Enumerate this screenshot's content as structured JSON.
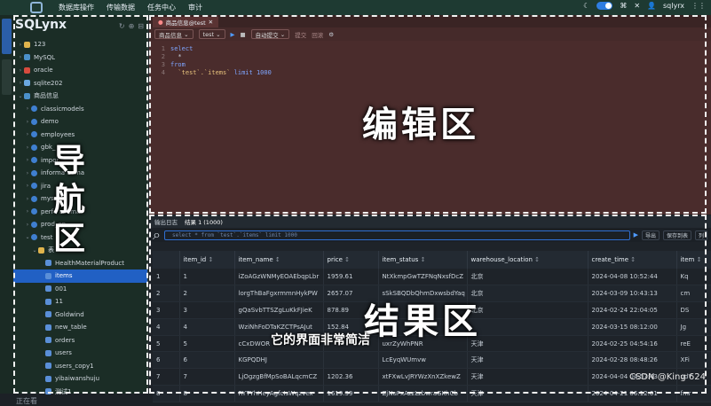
{
  "topbar": {
    "menu": [
      "数据库操作",
      "传输数据",
      "任务中心",
      "审计"
    ],
    "user": "sqlyrx"
  },
  "sidebar": {
    "brand": "SQLynx",
    "items": [
      {
        "label": "123",
        "icon": "folder",
        "indent": 1,
        "arrow": "›"
      },
      {
        "label": "MySQL",
        "icon": "mysql",
        "indent": 1,
        "arrow": "›"
      },
      {
        "label": "oracle",
        "icon": "oracle",
        "indent": 1,
        "arrow": "›"
      },
      {
        "label": "sqlite202",
        "icon": "sqlite",
        "indent": 1,
        "arrow": "›"
      },
      {
        "label": "商品信息",
        "icon": "mysql",
        "indent": 1,
        "arrow": "⌄"
      },
      {
        "label": "classicmodels",
        "icon": "db",
        "indent": 2,
        "arrow": "›"
      },
      {
        "label": "demo",
        "icon": "db",
        "indent": 2,
        "arrow": "›"
      },
      {
        "label": "employees",
        "icon": "db",
        "indent": 2,
        "arrow": "›"
      },
      {
        "label": "gbk_",
        "icon": "db",
        "indent": 2,
        "arrow": "›"
      },
      {
        "label": "impor",
        "icon": "db",
        "indent": 2,
        "arrow": "›"
      },
      {
        "label": "informa      hema",
        "icon": "db",
        "indent": 2,
        "arrow": "›"
      },
      {
        "label": "jira",
        "icon": "db",
        "indent": 2,
        "arrow": "›"
      },
      {
        "label": "mysq",
        "icon": "db",
        "indent": 2,
        "arrow": "›"
      },
      {
        "label": "perfo      chema",
        "icon": "db",
        "indent": 2,
        "arrow": "›"
      },
      {
        "label": "prod_op",
        "icon": "db",
        "indent": 2,
        "arrow": "›"
      },
      {
        "label": "test",
        "icon": "db",
        "indent": 2,
        "arrow": "⌄"
      },
      {
        "label": "表",
        "icon": "folder",
        "indent": 3,
        "arrow": "⌄"
      },
      {
        "label": "HealthMaterialProduct",
        "icon": "table",
        "indent": 4,
        "arrow": ""
      },
      {
        "label": "items",
        "icon": "table",
        "indent": 4,
        "arrow": "",
        "selected": true
      },
      {
        "label": "001",
        "icon": "table",
        "indent": 4,
        "arrow": ""
      },
      {
        "label": "11",
        "icon": "table",
        "indent": 4,
        "arrow": ""
      },
      {
        "label": "Goldwind",
        "icon": "table",
        "indent": 4,
        "arrow": ""
      },
      {
        "label": "new_table",
        "icon": "table",
        "indent": 4,
        "arrow": ""
      },
      {
        "label": "orders",
        "icon": "table",
        "indent": 4,
        "arrow": ""
      },
      {
        "label": "users",
        "icon": "table",
        "indent": 4,
        "arrow": ""
      },
      {
        "label": "users_copy1",
        "icon": "table",
        "indent": 4,
        "arrow": ""
      },
      {
        "label": "yibaiwanshuju",
        "icon": "table",
        "indent": 4,
        "arrow": ""
      },
      {
        "label": "测试1",
        "icon": "table",
        "indent": 4,
        "arrow": ""
      }
    ],
    "status": "正在看"
  },
  "editor": {
    "tab": "商品信息@test",
    "connection": "商品信息",
    "database": "test",
    "autocommit": "自动提交",
    "submit": "提交",
    "rollback": "回滚",
    "lines": [
      {
        "n": "1",
        "parts": [
          {
            "t": "select",
            "c": "kw"
          }
        ]
      },
      {
        "n": "2",
        "parts": [
          {
            "t": "  *",
            "c": ""
          }
        ]
      },
      {
        "n": "3",
        "parts": [
          {
            "t": "from",
            "c": "kw"
          }
        ]
      },
      {
        "n": "4",
        "parts": [
          {
            "t": "  `test`.`items` ",
            "c": "str"
          },
          {
            "t": "limit 1000",
            "c": "kw"
          }
        ]
      }
    ]
  },
  "results": {
    "tab_log": "输出日志",
    "tab_result": "结果 1 (1000)",
    "sql": "select * from `test`.`items` limit 1000",
    "export": "导出",
    "save": "保存到表",
    "columns_btn": "列",
    "headers": [
      "",
      "item_id",
      "item_name",
      "price",
      "item_status",
      "warehouse_location",
      "create_time",
      "item"
    ],
    "rows": [
      [
        "1",
        "1",
        "iZoAGzWNMyEOAEbqpLbr",
        "1959.61",
        "NtXkmpGwTZFNqNxsfDcZ",
        "北京",
        "2024-04-08 10:52:44",
        "Kq"
      ],
      [
        "2",
        "2",
        "lorgThBaFgxrmmnHykPW",
        "2657.07",
        "sSkSBQDbQhmDxwsbdYaq",
        "北京",
        "2024-03-09 10:43:13",
        "cm"
      ],
      [
        "3",
        "3",
        "gQaSvbTTSZgLuKkFJieK",
        "878.89",
        "",
        "北京",
        "2024-02-24 22:04:05",
        "DS"
      ],
      [
        "4",
        "4",
        "WziNhFoDTaKZCTPsAJut",
        "152.84",
        "",
        "",
        "2024-03-15 08:12:00",
        "Jg"
      ],
      [
        "5",
        "5",
        "cCxDWOR",
        "",
        "uxrZyWhPNR",
        "天津",
        "2024-02-25 04:54:16",
        "reE"
      ],
      [
        "6",
        "6",
        "KGPQDHJ",
        "",
        "LcEyqWUmvw",
        "天津",
        "2024-02-28 08:48:26",
        "XFi"
      ],
      [
        "7",
        "7",
        "LjOgzgBfMpSoBALqcmCZ",
        "1202.36",
        "xtFXwLvJRYWzXnXZkewZ",
        "天津",
        "2024-04-04 04:57:43",
        "udY"
      ],
      [
        "8",
        "8",
        "RYTYhHeyAgfcIsWqzvex",
        "1619.39",
        "ZjNuFxAzzLzbwraGKhCb",
        "天津",
        "2024-04-21 06:12:01",
        "fmr"
      ]
    ]
  },
  "overlay": {
    "editor_label": "编辑区",
    "nav_label": "导航区",
    "result_label": "结果区",
    "caption": "它的界面非常简洁",
    "watermark": "CSDN @King 624"
  }
}
